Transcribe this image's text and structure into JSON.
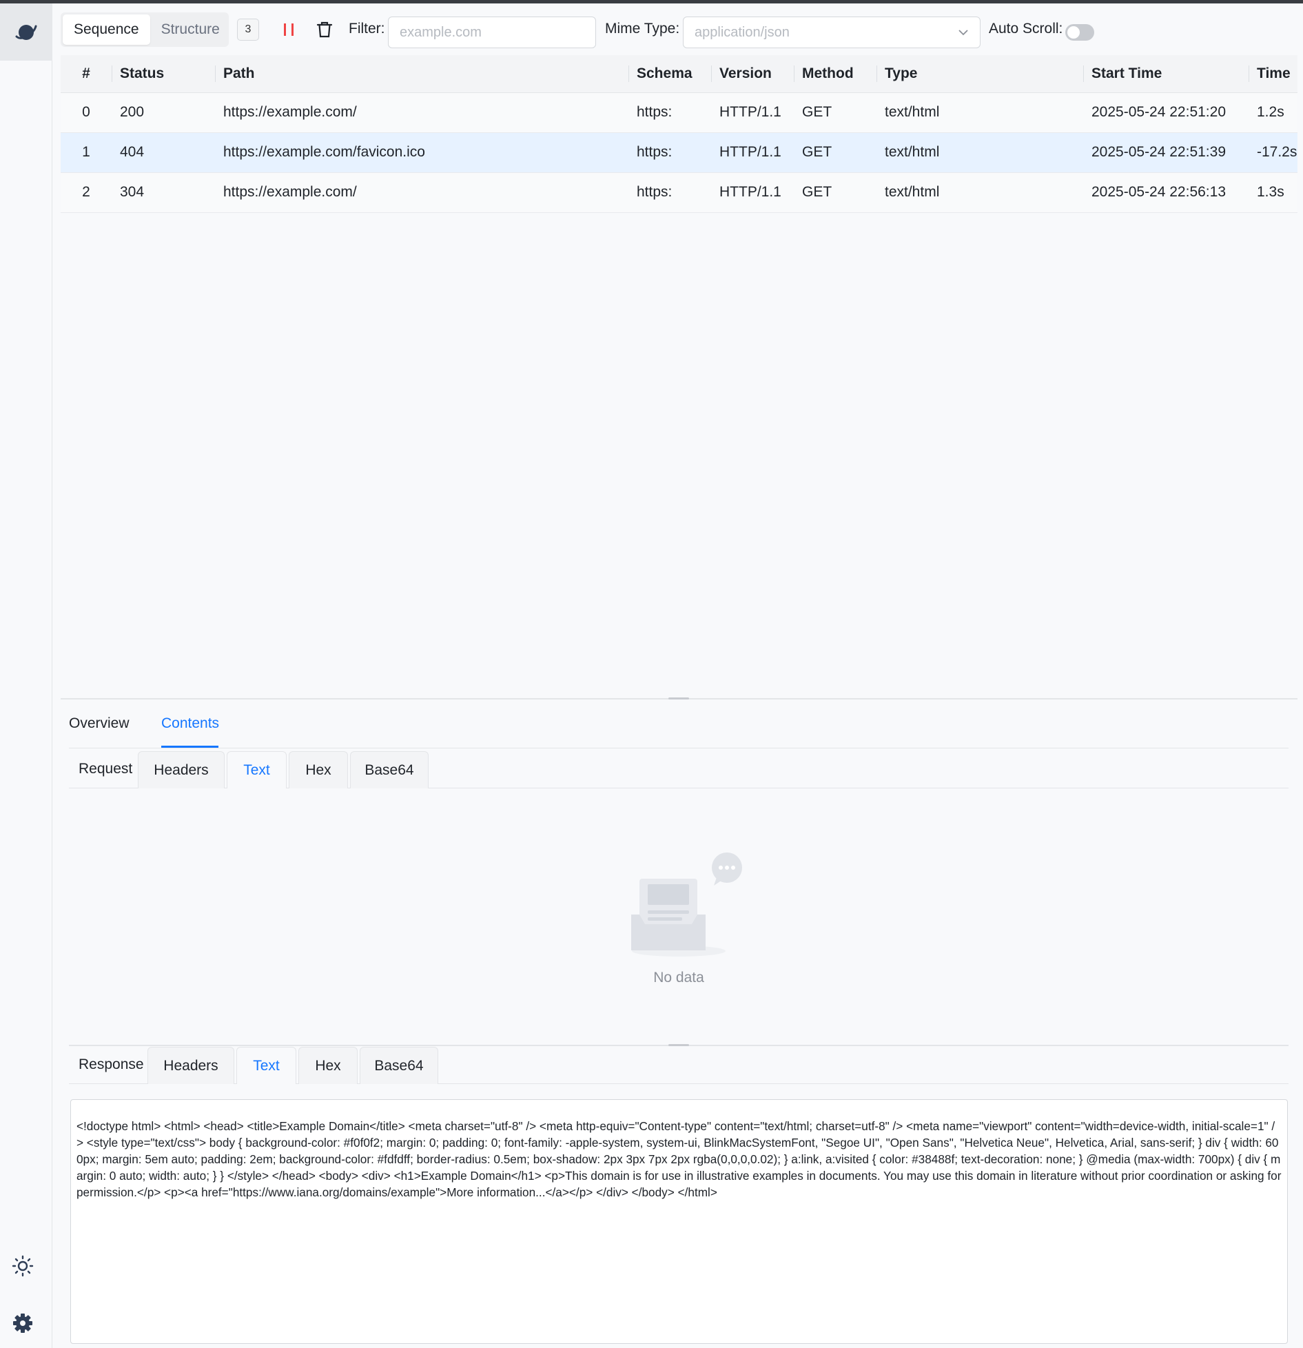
{
  "toolbar": {
    "view_tabs": [
      "Sequence",
      "Structure"
    ],
    "request_count": "3",
    "filter_label": "Filter:",
    "filter_placeholder": "example.com",
    "mime_label": "Mime Type:",
    "mime_placeholder": "application/json",
    "autoscroll_label": "Auto Scroll:",
    "autoscroll_on": false
  },
  "table": {
    "headers": [
      "#",
      "Status",
      "Path",
      "Schema",
      "Version",
      "Method",
      "Type",
      "Start Time",
      "Time"
    ],
    "rows": [
      {
        "id": "0",
        "status": "200",
        "path": "https://example.com/",
        "schema": "https:",
        "version": "HTTP/1.1",
        "method": "GET",
        "type": "text/html",
        "start": "2025-05-24 22:51:20",
        "time": "1.2s"
      },
      {
        "id": "1",
        "status": "404",
        "path": "https://example.com/favicon.ico",
        "schema": "https:",
        "version": "HTTP/1.1",
        "method": "GET",
        "type": "text/html",
        "start": "2025-05-24 22:51:39",
        "time": "-17.2s"
      },
      {
        "id": "2",
        "status": "304",
        "path": "https://example.com/",
        "schema": "https:",
        "version": "HTTP/1.1",
        "method": "GET",
        "type": "text/html",
        "start": "2025-05-24 22:56:13",
        "time": "1.3s"
      }
    ],
    "selected_row": "1"
  },
  "detail": {
    "tabs": [
      "Overview",
      "Contents"
    ],
    "active_tab": "Contents",
    "request": {
      "label": "Request",
      "tabs": [
        "Headers",
        "Text",
        "Hex",
        "Base64"
      ],
      "active": "Text",
      "empty_text": "No data"
    },
    "response": {
      "label": "Response",
      "tabs": [
        "Headers",
        "Text",
        "Hex",
        "Base64"
      ],
      "active": "Text",
      "body": "<!doctype html> <html> <head> <title>Example Domain</title> <meta charset=\"utf-8\" /> <meta http-equiv=\"Content-type\" content=\"text/html; charset=utf-8\" /> <meta name=\"viewport\" content=\"width=device-width, initial-scale=1\" /> <style type=\"text/css\"> body { background-color: #f0f0f2; margin: 0; padding: 0; font-family: -apple-system, system-ui, BlinkMacSystemFont, \"Segoe UI\", \"Open Sans\", \"Helvetica Neue\", Helvetica, Arial, sans-serif; } div { width: 600px; margin: 5em auto; padding: 2em; background-color: #fdfdff; border-radius: 0.5em; box-shadow: 2px 3px 7px 2px rgba(0,0,0,0.02); } a:link, a:visited { color: #38488f; text-decoration: none; } @media (max-width: 700px) { div { margin: 0 auto; width: auto; } } </style> </head> <body> <div> <h1>Example Domain</h1> <p>This domain is for use in illustrative examples in documents. You may use this domain in literature without prior coordination or asking for permission.</p> <p><a href=\"https://www.iana.org/domains/example\">More information...</a></p> </div> </body> </html>"
    }
  },
  "icons": {
    "logo": "planet-icon",
    "pause": "pause-icon",
    "clear": "trash-icon",
    "theme": "sun-icon",
    "settings": "gear-icon"
  },
  "colors": {
    "accent": "#1677ff",
    "pause": "#ef4444",
    "selected_row": "#e7f2ff"
  }
}
